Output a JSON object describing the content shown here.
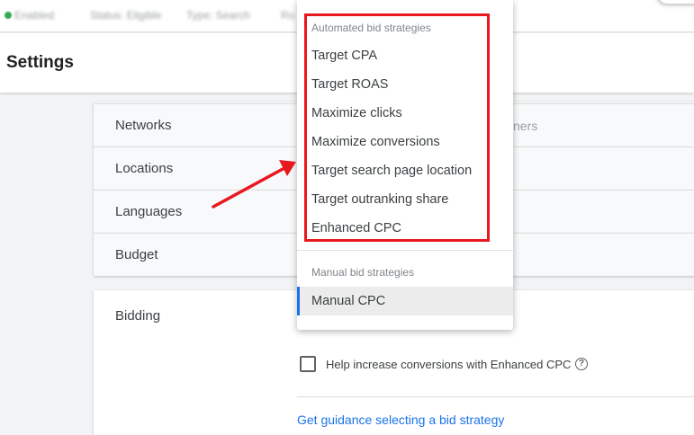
{
  "status_bar": {
    "status": "Enabled",
    "status_field": "Status: Eligible",
    "type_field": "Type: Search",
    "extra": "Ro"
  },
  "page": {
    "title": "Settings"
  },
  "settings_rows": [
    {
      "label": "Networks",
      "value": "ners"
    },
    {
      "label": "Locations",
      "value": ""
    },
    {
      "label": "Languages",
      "value": ""
    },
    {
      "label": "Budget",
      "value": ""
    }
  ],
  "bidding": {
    "label": "Bidding",
    "checkbox_label": "Help increase conversions with Enhanced CPC",
    "help_icon": "?",
    "guidance_link": "Get guidance selecting a bid strategy"
  },
  "dropdown": {
    "automated_group_label": "Automated bid strategies",
    "automated_items": [
      "Target CPA",
      "Target ROAS",
      "Maximize clicks",
      "Maximize conversions",
      "Target search page location",
      "Target outranking share",
      "Enhanced CPC"
    ],
    "manual_group_label": "Manual bid strategies",
    "manual_items": [
      "Manual CPC"
    ],
    "selected": "Manual CPC"
  },
  "annotation": {
    "highlight_color": "#e8181f",
    "arrow_icon": "red-arrow-icon"
  },
  "colors": {
    "accent": "#1a73e8",
    "status_green": "#34a853"
  }
}
